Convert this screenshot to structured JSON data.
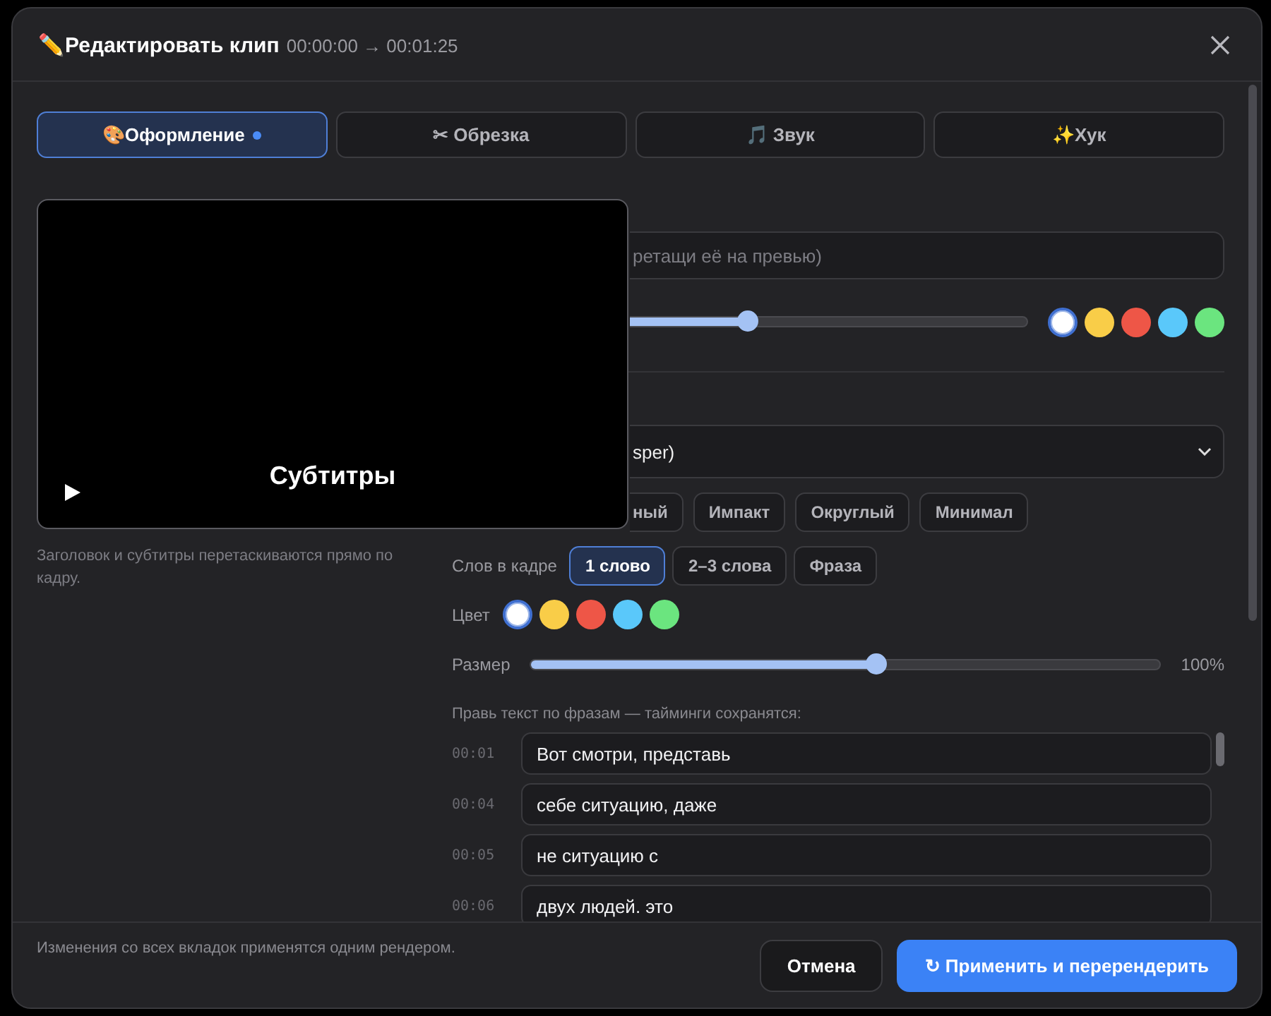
{
  "dialog": {
    "title": "✏️Редактировать клип",
    "time_range": "00:00:00 → 00:01:25"
  },
  "tabs": [
    {
      "label": "🎨Оформление",
      "selected": true,
      "modified": true
    },
    {
      "label": "✂ Обрезка",
      "selected": false,
      "modified": false
    },
    {
      "label": "🎵 Звук",
      "selected": false,
      "modified": false
    },
    {
      "label": "✨Хук",
      "selected": false,
      "modified": false
    }
  ],
  "preview": {
    "subtitle": "Субтитры"
  },
  "hint": "Заголовок и субтитры перетаскиваются прямо по кадру.",
  "title_field": {
    "placeholder": "ретащи её на превью)"
  },
  "title_size_slider": {
    "level": 0.3
  },
  "title_colors": [
    {
      "color": "#ffffff",
      "selected": true
    },
    {
      "color": "#f9cd48",
      "selected": false
    },
    {
      "color": "#ee5647",
      "selected": false
    },
    {
      "color": "#5ac8fa",
      "selected": false
    },
    {
      "color": "#6be57f",
      "selected": false
    }
  ],
  "subtitle_font_select": {
    "value": "sper)"
  },
  "styles": [
    {
      "label": "ный",
      "selected": false
    },
    {
      "label": "Импакт",
      "selected": false
    },
    {
      "label": "Округлый",
      "selected": false
    },
    {
      "label": "Минимал",
      "selected": false
    }
  ],
  "words_per_frame": {
    "label": "Слов в кадре",
    "options": [
      {
        "label": "1 слово",
        "selected": true
      },
      {
        "label": "2–3 слова",
        "selected": false
      },
      {
        "label": "Фраза",
        "selected": false
      }
    ]
  },
  "subtitle_color": {
    "label": "Цвет",
    "colors": [
      {
        "color": "#ffffff",
        "selected": true
      },
      {
        "color": "#f9cd48",
        "selected": false
      },
      {
        "color": "#ee5647",
        "selected": false
      },
      {
        "color": "#5ac8fa",
        "selected": false
      },
      {
        "color": "#6be57f",
        "selected": false
      }
    ]
  },
  "size": {
    "label": "Размер",
    "level": 0.55,
    "reading": "100%"
  },
  "phrases": {
    "label": "Правь текст по фразам — тайминги сохранятся:",
    "items": [
      {
        "time": "00:01",
        "text": "Вот смотри, представь"
      },
      {
        "time": "00:04",
        "text": "себе ситуацию, даже"
      },
      {
        "time": "00:05",
        "text": "не ситуацию с"
      },
      {
        "time": "00:06",
        "text": "двух людей. это"
      }
    ]
  },
  "footer": {
    "note": "Изменения со всех вкладок применятся одним рендером.",
    "buttons": [
      {
        "label": "Отмена",
        "kind": "secondary"
      },
      {
        "label": "↻ Применить и перерендерить",
        "kind": "primary"
      }
    ]
  }
}
